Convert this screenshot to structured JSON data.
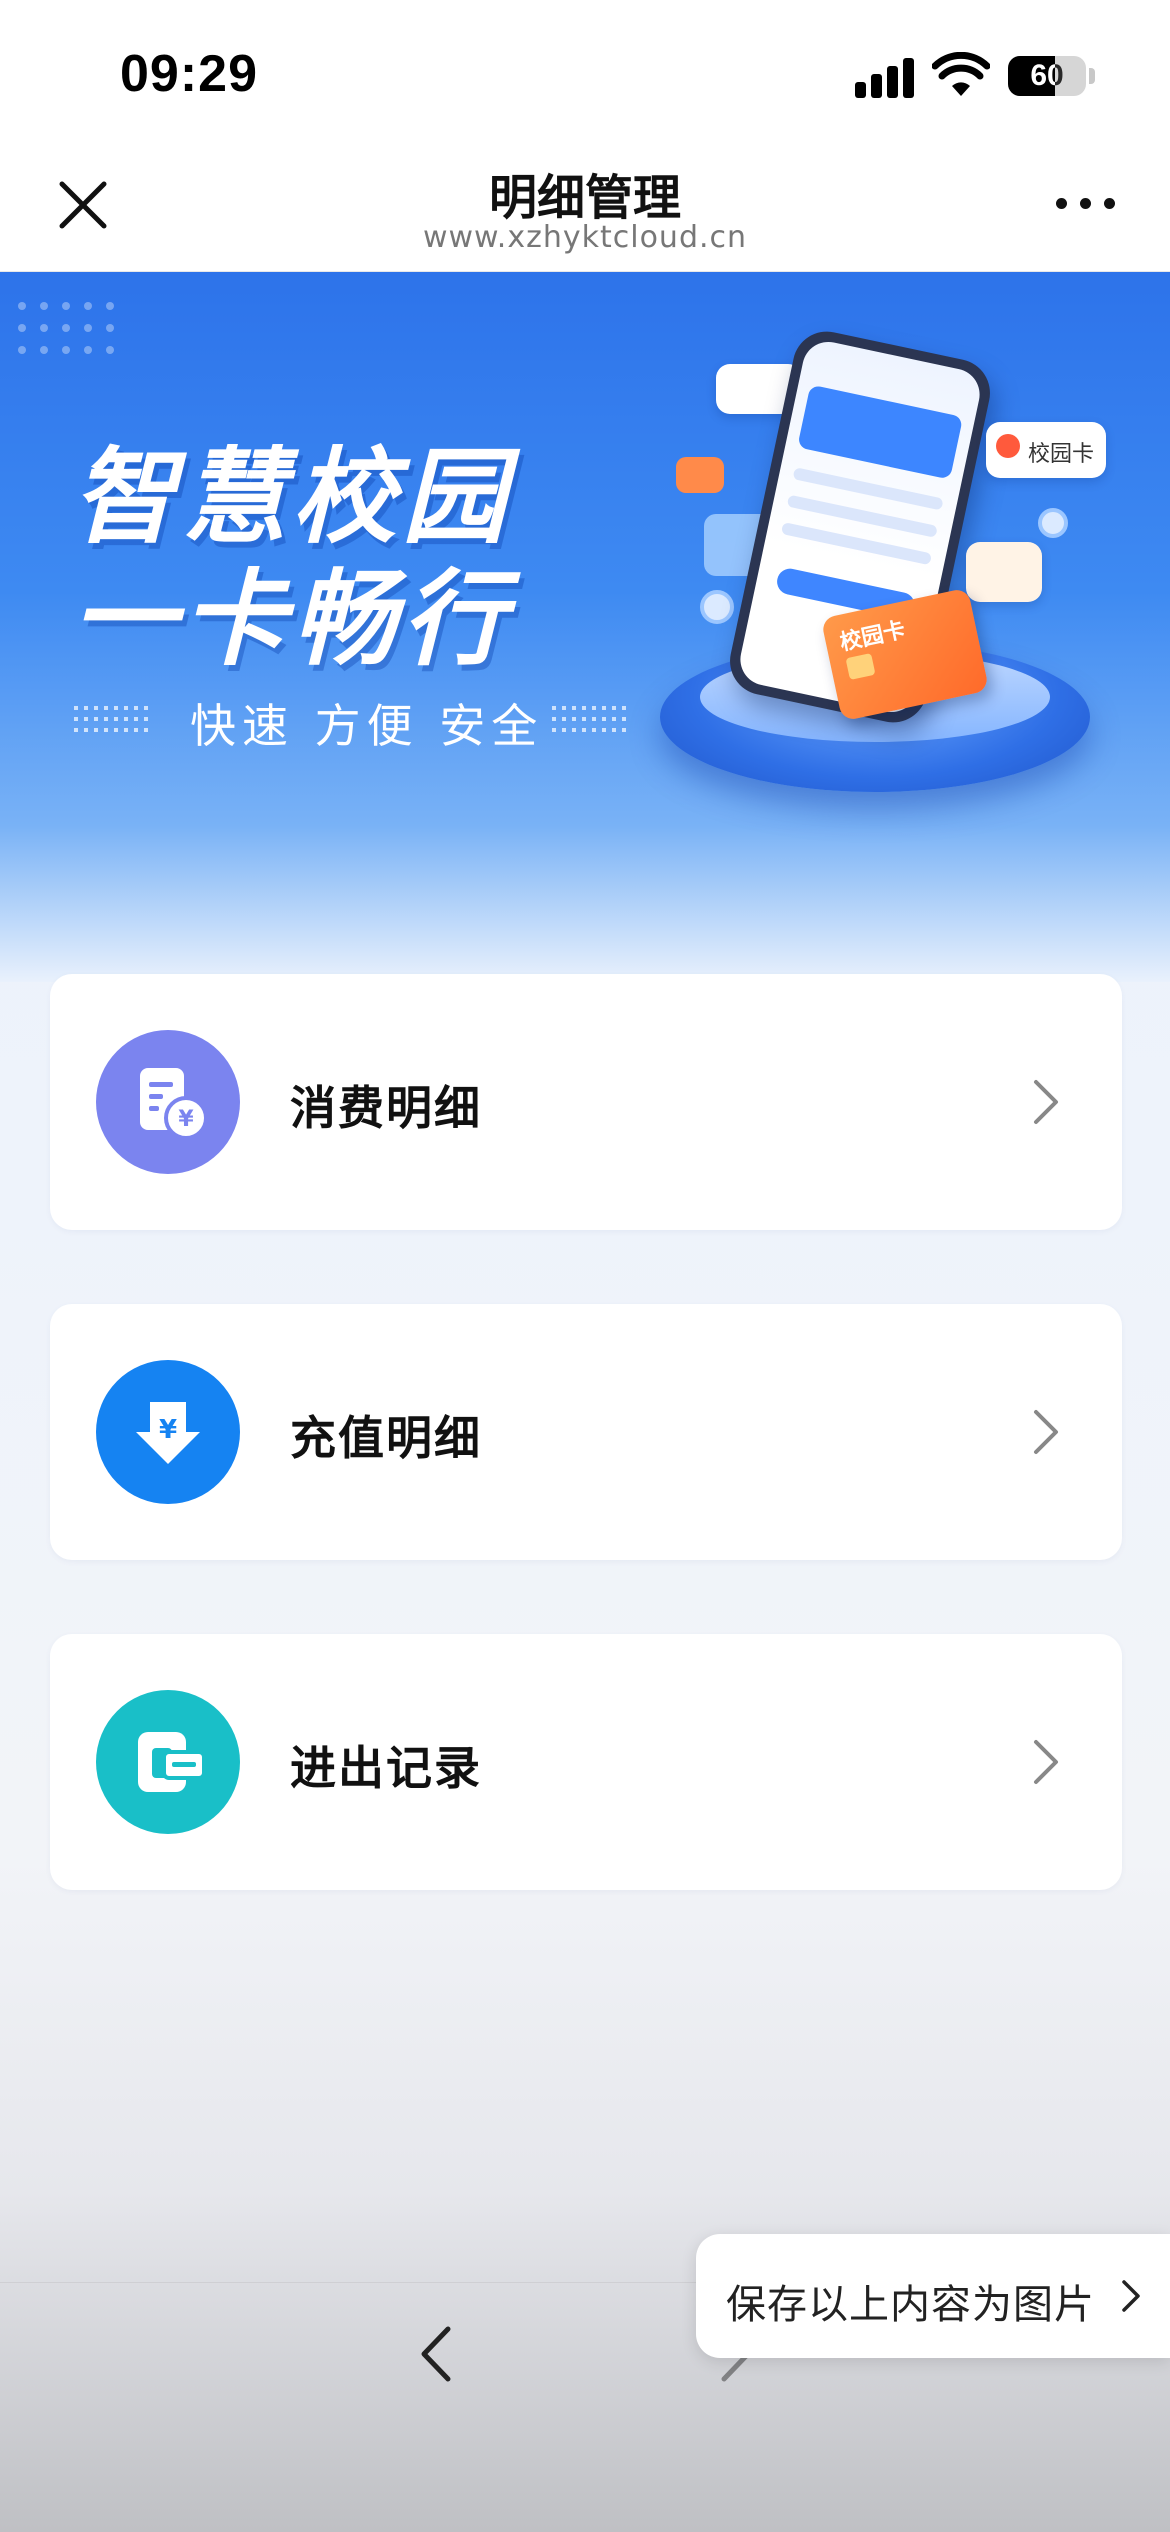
{
  "status_bar": {
    "time": "09:29",
    "battery_level": "60",
    "battery_fraction": 0.6
  },
  "nav": {
    "title": "明细管理",
    "url": "www.xzhyktcloud.cn"
  },
  "banner": {
    "title_line1": "智慧校园",
    "title_line2": "一卡畅行",
    "tagline": "快速 方便 安全",
    "card_label": "校园卡",
    "bubble_text": "校园卡",
    "accent_color": "#2d73ea"
  },
  "menu": {
    "items": [
      {
        "label": "消费明细",
        "icon": "receipt-yuan-icon",
        "color": "#7b84ef"
      },
      {
        "label": "充值明细",
        "icon": "yuan-download-icon",
        "color": "#1583f2"
      },
      {
        "label": "进出记录",
        "icon": "card-reader-icon",
        "color": "#19bfc8"
      }
    ]
  },
  "bottom_bar": {
    "save_image_label": "保存以上内容为图片"
  }
}
